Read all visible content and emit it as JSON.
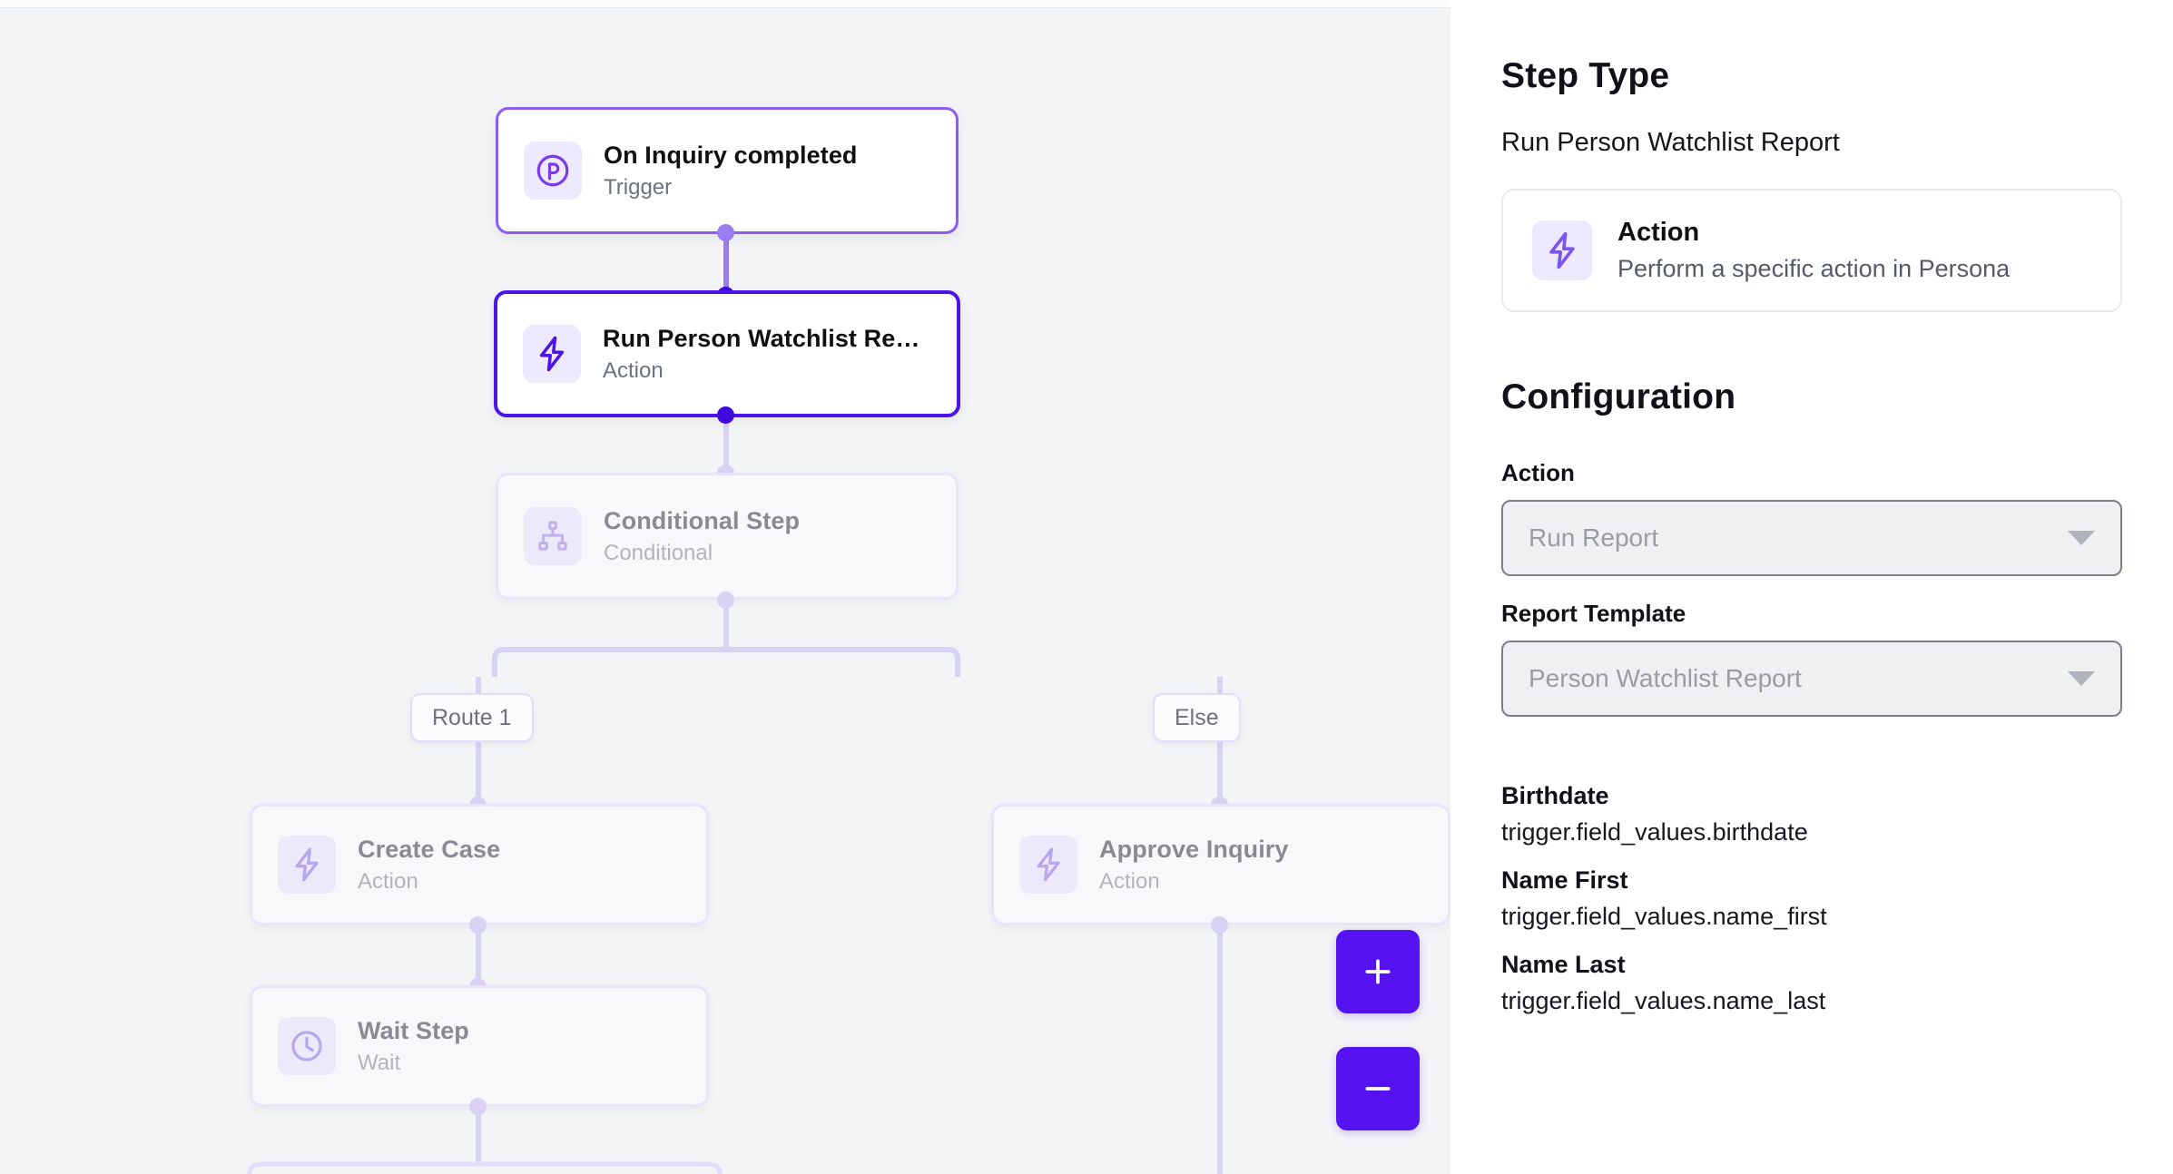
{
  "canvas": {
    "nodes": [
      {
        "id": "trigger",
        "title": "On Inquiry completed",
        "subtitle": "Trigger",
        "icon": "persona-logo-icon"
      },
      {
        "id": "action",
        "title": "Run Person Watchlist Re…",
        "subtitle": "Action",
        "icon": "lightning-bolt-icon"
      },
      {
        "id": "conditional",
        "title": "Conditional Step",
        "subtitle": "Conditional",
        "icon": "hierarchy-icon"
      },
      {
        "id": "create-case",
        "title": "Create Case",
        "subtitle": "Action",
        "icon": "lightning-bolt-icon"
      },
      {
        "id": "wait-step",
        "title": "Wait Step",
        "subtitle": "Wait",
        "icon": "clock-icon"
      },
      {
        "id": "approve",
        "title": "Approve Inquiry",
        "subtitle": "Action",
        "icon": "lightning-bolt-icon"
      }
    ],
    "branches": [
      {
        "id": "route-1",
        "label": "Route 1"
      },
      {
        "id": "else",
        "label": "Else"
      }
    ],
    "zoom_controls": {
      "zoom_in_label": "+",
      "zoom_out_label": "−"
    }
  },
  "panel": {
    "step_type_heading": "Step Type",
    "step_type_value": "Run Person Watchlist Report",
    "type_card": {
      "title": "Action",
      "description": "Perform a specific action in Persona",
      "icon": "lightning-bolt-icon"
    },
    "configuration_heading": "Configuration",
    "fields": [
      {
        "label": "Action",
        "value": "Run Report"
      },
      {
        "label": "Report Template",
        "value": "Person Watchlist Report"
      }
    ],
    "data_mappings": [
      {
        "key": "Birthdate",
        "value": "trigger.field_values.birthdate"
      },
      {
        "key": "Name First",
        "value": "trigger.field_values.name_first"
      },
      {
        "key": "Name Last",
        "value": "trigger.field_values.name_last"
      }
    ]
  },
  "colors": {
    "accent": "#5613f1",
    "accent_strong": "#4c14e8",
    "accent_light": "#8b5cf6",
    "icon_bg": "#ede9fe",
    "canvas_bg": "#f3f4f6",
    "edge": "#cfc4f3"
  }
}
